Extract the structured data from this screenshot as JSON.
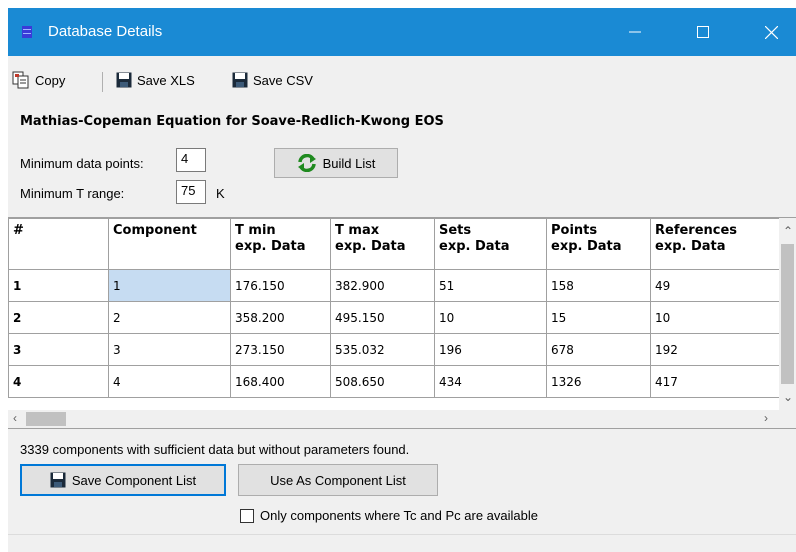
{
  "window": {
    "title": "Database Details",
    "title_bar_color": "#1a8ad4"
  },
  "toolbar": {
    "copy_label": "Copy",
    "save_xls_label": "Save XLS",
    "save_csv_label": "Save CSV"
  },
  "heading": "Mathias-Copeman Equation for Soave-Redlich-Kwong EOS",
  "filters": {
    "min_points_label": "Minimum data points:",
    "min_points_value": "4",
    "min_t_range_label": "Minimum T range:",
    "min_t_range_value": "75",
    "min_t_range_unit": "K",
    "build_list_label": "Build List"
  },
  "grid": {
    "headers": [
      [
        "#",
        ""
      ],
      [
        "Component",
        ""
      ],
      [
        "T min",
        "exp. Data"
      ],
      [
        "T max",
        "exp. Data"
      ],
      [
        "Sets",
        "exp. Data"
      ],
      [
        "Points",
        "exp. Data"
      ],
      [
        "References",
        "exp. Data"
      ]
    ],
    "rows": [
      [
        "1",
        "1",
        "176.150",
        "382.900",
        "51",
        "158",
        "49"
      ],
      [
        "2",
        "2",
        "358.200",
        "495.150",
        "10",
        "15",
        "10"
      ],
      [
        "3",
        "3",
        "273.150",
        "535.032",
        "196",
        "678",
        "192"
      ],
      [
        "4",
        "4",
        "168.400",
        "508.650",
        "434",
        "1326",
        "417"
      ]
    ],
    "selected_cell": {
      "row": 0,
      "col": 1
    }
  },
  "status": "3339 components with sufficient data but without parameters found.",
  "actions": {
    "save_component_list_label": "Save Component List",
    "use_as_component_list_label": "Use As Component List",
    "only_tc_pc_label": "Only components where Tc and Pc are available",
    "only_tc_pc_checked": false
  }
}
